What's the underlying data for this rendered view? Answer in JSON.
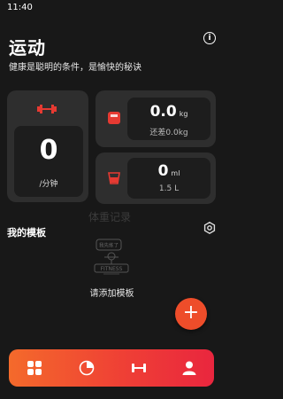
{
  "status_bar": {
    "time": "11:40"
  },
  "header": {
    "title": "运动",
    "subtitle": "健康是聪明的条件，是愉快的秘诀",
    "info_icon": "info-icon"
  },
  "exercise_card": {
    "icon": "dumbbell-icon",
    "value": "0",
    "unit": "/分钟"
  },
  "weight_card": {
    "icon": "scale-icon",
    "value": "0.0",
    "unit": "kg",
    "caption": "还差0.0kg"
  },
  "water_card": {
    "icon": "water-cup-icon",
    "value": "0",
    "unit": "ml",
    "caption": "1.5 L"
  },
  "watermark": "体重记录",
  "templates": {
    "title": "我的模板",
    "settings_icon": "settings-icon",
    "empty_text": "请添加模板",
    "illustration_text": "FITNESS",
    "bubble_text": "我先练了"
  },
  "fab": {
    "label": "+"
  },
  "bottom_nav": {
    "items": [
      {
        "icon": "grid-icon",
        "active": true
      },
      {
        "icon": "pie-chart-icon",
        "active": false
      },
      {
        "icon": "dumbbell-icon",
        "active": false
      },
      {
        "icon": "person-icon",
        "active": false
      }
    ]
  },
  "colors": {
    "accent": "#ef4035",
    "background": "#181818",
    "card": "#2e2e2e"
  }
}
